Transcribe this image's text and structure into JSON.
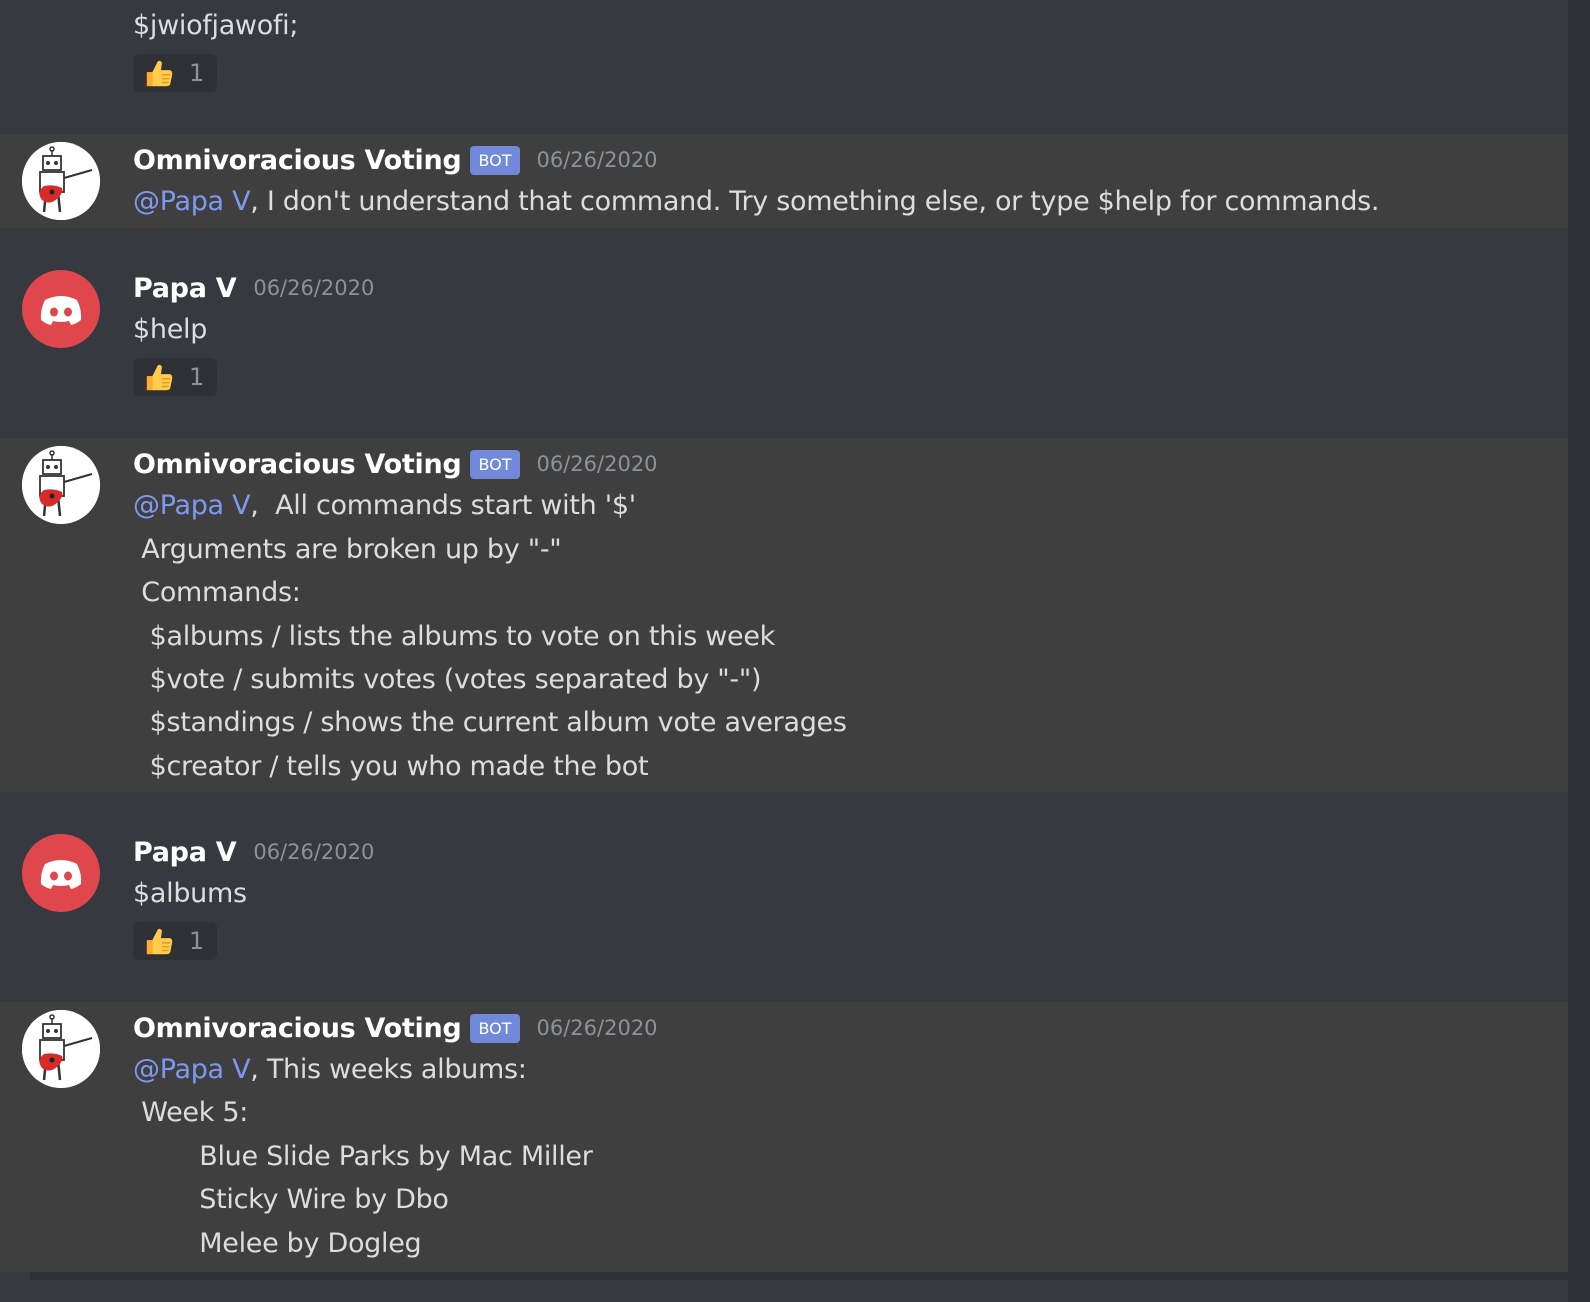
{
  "messages": [
    {
      "lines": [
        "$jwiofjawofi;"
      ],
      "reaction": {
        "emoji": "thumbs-up",
        "count": "1"
      }
    },
    {
      "author": "Omnivoracious Voting",
      "bot_tag": "BOT",
      "timestamp": "06/26/2020",
      "mention": "@Papa V",
      "first_line": ", I don't understand that command. Try something else, or type $help for commands."
    },
    {
      "author": "Papa V",
      "timestamp": "06/26/2020",
      "lines": [
        "$help"
      ],
      "reaction": {
        "emoji": "thumbs-up",
        "count": "1"
      }
    },
    {
      "author": "Omnivoracious Voting",
      "bot_tag": "BOT",
      "timestamp": "06/26/2020",
      "mention": "@Papa V",
      "first_line": ",  All commands start with '$'",
      "lines": [
        " Arguments are broken up by \"-\"",
        " Commands:",
        "  $albums / lists the albums to vote on this week",
        "  $vote / submits votes (votes separated by \"-\")",
        "  $standings / shows the current album vote averages",
        "  $creator / tells you who made the bot"
      ]
    },
    {
      "author": "Papa V",
      "timestamp": "06/26/2020",
      "lines": [
        "$albums"
      ],
      "reaction": {
        "emoji": "thumbs-up",
        "count": "1"
      }
    },
    {
      "author": "Omnivoracious Voting",
      "bot_tag": "BOT",
      "timestamp": "06/26/2020",
      "mention": "@Papa V",
      "first_line": ", This weeks albums:",
      "lines": [
        " Week 5:",
        "        Blue Slide Parks by Mac Miller",
        "        Sticky Wire by Dbo",
        "        Melee by Dogleg"
      ]
    }
  ],
  "colors": {
    "background": "#36393f",
    "bot_highlight": "#3f3f3f",
    "mention": "#7f98f0",
    "bot_tag": "#7289da",
    "discord_avatar": "#e0474d"
  },
  "icons": {
    "discord_avatar": "discord-logo-icon",
    "bot_avatar": "robot-guitar-icon",
    "reaction": "thumbs-up-icon"
  }
}
